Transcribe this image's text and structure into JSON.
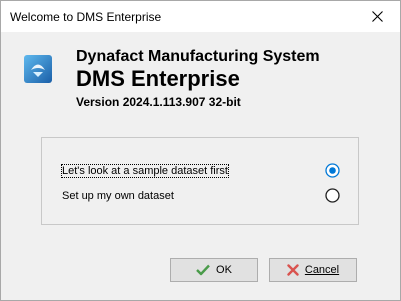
{
  "window": {
    "title": "Welcome to DMS Enterprise"
  },
  "header": {
    "company_line": "Dynafact Manufacturing System",
    "product_name": "DMS Enterprise",
    "version": "Version 2024.1.113.907 32-bit",
    "logo_icon": "dms-logo-icon"
  },
  "options": [
    {
      "label": "Let's look at a sample dataset first",
      "selected": true
    },
    {
      "label": "Set up my own dataset",
      "selected": false
    }
  ],
  "buttons": {
    "ok_label": "OK",
    "cancel_label": "Cancel"
  },
  "colors": {
    "radio_accent": "#0078d7",
    "ok_check": "#4a9b4a",
    "cancel_x": "#d9534f"
  }
}
